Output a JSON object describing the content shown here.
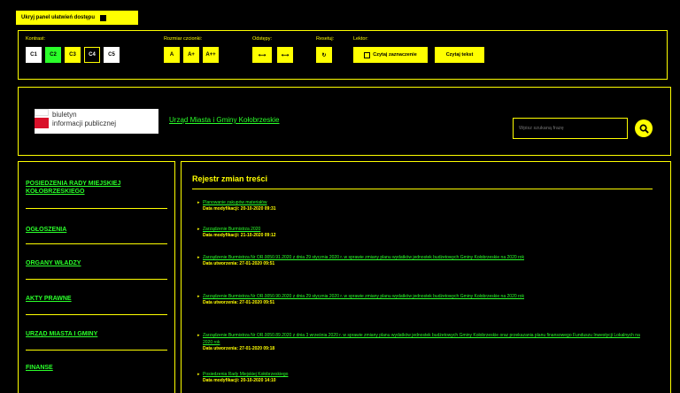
{
  "top_bar": {
    "hide_panel_label": "Ukryj panel ułatwień dostępu"
  },
  "accessibility": {
    "contrast": {
      "label": "Kontrast:",
      "options": [
        "C1",
        "C2",
        "C3",
        "C4",
        "C5"
      ]
    },
    "font_size": {
      "label": "Rozmiar czcionki:",
      "options": [
        "A",
        "A+",
        "A++"
      ]
    },
    "spacing": {
      "label": "Odstępy:",
      "options": [
        "⟷",
        "⟷"
      ]
    },
    "reset": {
      "label": "Resetuj:"
    },
    "reader": {
      "label": "Lektor:",
      "read_selected": "Czytaj zaznaczenie",
      "read_text": "Czytaj tekst"
    },
    "colors": {
      "accent": "#ffff00",
      "green": "#2aff2a",
      "background": "#000000"
    }
  },
  "header": {
    "bip_line1": "biuletyn",
    "bip_line2": "informacji publicznej",
    "site_title": "Urząd Miasta i Gminy Kołobrzeskie",
    "search_placeholder": "Wpisz szukaną frazę"
  },
  "sidebar": {
    "items": [
      "POSIEDZENIA RADY MIEJSKIEJ KOŁOBRZESKIEGO",
      "OGŁOSZENIA",
      "ORGANY WŁADZY",
      "AKTY PRAWNE",
      "URZĄD MIASTA I GMINY",
      "FINANSE"
    ]
  },
  "main": {
    "title": "Rejestr zmian treści",
    "entries": [
      {
        "link": "Planowanie zakupów materiałów",
        "date": "Data modyfikacji: 20-10-2020 09:31"
      },
      {
        "link": "Zarządzenie Burmistrza 2020",
        "date": "Data modyfikacji: 21-10-2020 09:12"
      },
      {
        "link": "Zarządzenie Burmistrza Nr OR.0050.91.2020 z dnia 29 stycznia 2020 r. w sprawie zmiany planu wydatków jednostek budżetowych Gminy Kołobrzeskie na 2020 rok",
        "date": "Data utworzenia: 27-01-2020 09:51"
      },
      {
        "link": "Zarządzenie Burmistrza Nr OR.0050.90.2020 z dnia 29 stycznia 2020 r. w sprawie zmiany planu wydatków jednostek budżetowych Gminy Kołobrzeskie na 2020 rok",
        "date": "Data utworzenia: 27-01-2020 09:51"
      },
      {
        "link": "Zarządzenie Burmistrza Nr OR.0050.89.2020 z dnia 3 września 2020 r. w sprawie zmiany planu wydatków jednostek budżetowych Gminy Kołobrzeskie oraz przekazania planu finansowego Funduszu Inwestycji Lokalnych na 2020 rok",
        "date": "Data utworzenia: 27-01-2020 09:18"
      },
      {
        "link": "Posiedzenia Rady Miejskiej Kołobrzeskiego",
        "date": "Data modyfikacji: 20-10-2020 14:10"
      }
    ]
  }
}
